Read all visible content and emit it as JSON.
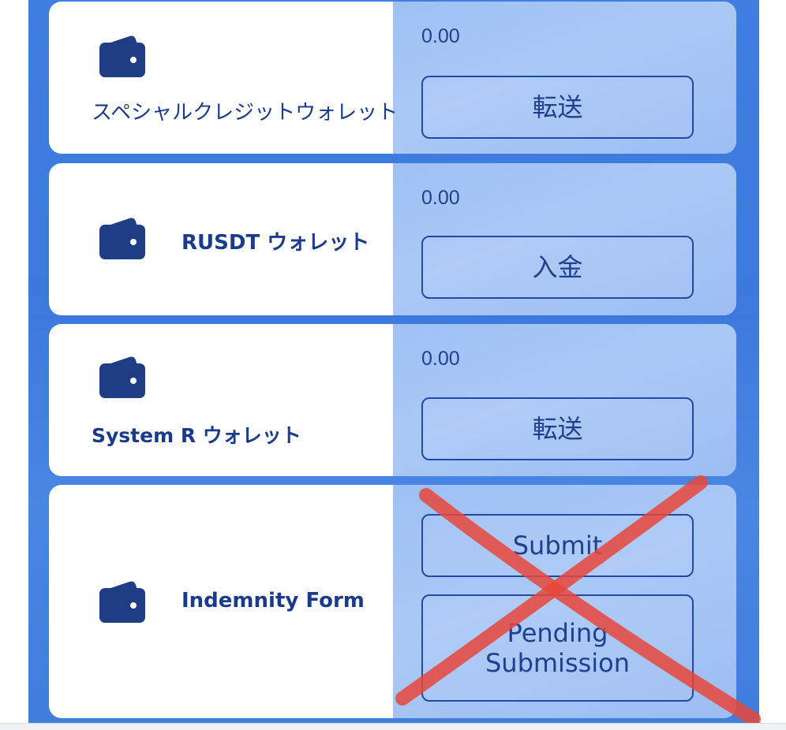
{
  "wallets": [
    {
      "label": "スペシャルクレジットウォレット",
      "amount": "0.00",
      "action": "転送",
      "icon": "wallet-icon"
    },
    {
      "label": "RUSDT ウォレット",
      "amount": "0.00",
      "action": "入金",
      "icon": "wallet-icon"
    },
    {
      "label": "System R ウォレット",
      "amount": "0.00",
      "action": "転送",
      "icon": "wallet-icon"
    }
  ],
  "indemnity": {
    "label": "Indemnity Form",
    "submit_label": "Submit",
    "pending_label": "Pending Submission",
    "icon": "wallet-icon"
  },
  "colors": {
    "accent": "#1a3a8c",
    "background_blue": "#3f7fe0",
    "panel_light_blue": "#a3c3f5",
    "overlay_cross": "#e8463a"
  }
}
